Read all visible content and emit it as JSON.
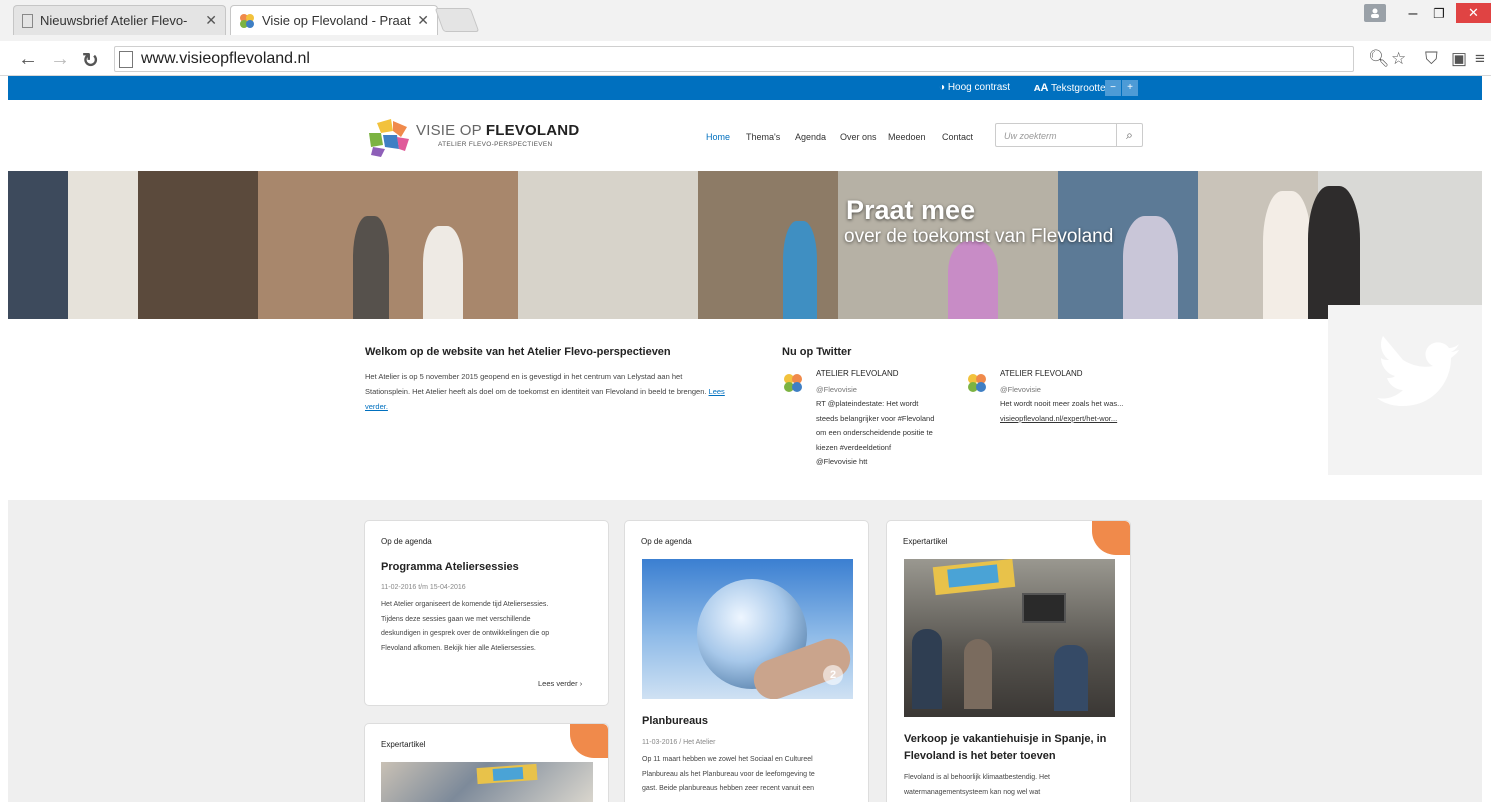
{
  "browser": {
    "tabs": [
      {
        "label": "Nieuwsbrief Atelier Flevo-"
      },
      {
        "label": "Visie op Flevoland - Praat"
      }
    ],
    "url": "www.visieopflevoland.nl",
    "close_glyph": "✕",
    "new_tab": ""
  },
  "util": {
    "contrast": "Hoog contrast",
    "text_size": "Tekstgrootte",
    "minus": "−",
    "plus": "+"
  },
  "header": {
    "logo_line1_light": "VISIE OP ",
    "logo_line1_bold": "FLEVOLAND",
    "logo_line2": "ATELIER FLEVO-PERSPECTIEVEN",
    "nav": [
      "Home",
      "Thema's",
      "Agenda",
      "Over ons",
      "Meedoen",
      "Contact"
    ],
    "search_placeholder": "Uw zoekterm"
  },
  "hero": {
    "headline": "Praat mee",
    "subline": "over de toekomst van Flevoland"
  },
  "welcome": {
    "title": "Welkom op de website van het Atelier Flevo-perspectieven",
    "text": "Het Atelier is op 5 november 2015 geopend en is gevestigd in het centrum van Lelystad aan het Stationsplein. Het Atelier heeft als doel om de toekomst en identiteit van Flevoland in beeld te brengen. ",
    "link": "Lees verder."
  },
  "twitter": {
    "title": "Nu op Twitter",
    "tweets": [
      {
        "name": "ATELIER FLEVOLAND",
        "handle": "@Flevovisie",
        "lines": [
          "RT @plateindestate: Het wordt",
          "steeds belangrijker voor #Flevoland",
          "om een onderscheidende positie te",
          "kiezen #verdeeldetionf",
          "@Flevovisie htt"
        ]
      },
      {
        "name": "ATELIER FLEVOLAND",
        "handle": "@Flevovisie",
        "lines": [
          "Het wordt nooit meer zoals het was...",
          "visieopflevoland.nl/expert/het-wor..."
        ]
      }
    ]
  },
  "cards": [
    {
      "category": "Op de agenda",
      "title": "Programma Ateliersessies",
      "date": "11-02-2016 t/m 15-04-2016",
      "lines": [
        "Het Atelier organiseert de komende tijd Ateliersessies.",
        "Tijdens deze sessies gaan we met verschillende",
        "deskundigen in gesprek over de ontwikkelingen die op",
        "Flevoland afkomen. Bekijk hier alle Ateliersessies."
      ],
      "more": "Lees verder ›"
    },
    {
      "category": "Expertartikel"
    },
    {
      "category": "Op de agenda",
      "image_badge": "2",
      "title": "Planbureaus",
      "date": "11-03-2016 / Het Atelier",
      "lines": [
        "Op 11 maart hebben we zowel het Sociaal en Cultureel",
        "Planbureau als het Planbureau voor de leefomgeving te",
        "gast. Beide planbureaus hebben zeer recent vanuit een"
      ]
    },
    {
      "category": "Expertartikel",
      "title_lines": [
        "Verkoop je vakantiehuisje in Spanje, in",
        "Flevoland is het beter toeven"
      ],
      "lines": [
        "Flevoland is al behoorlijk klimaatbestendig. Het",
        "watermanagementsysteem kan nog wel wat"
      ]
    }
  ],
  "colors": {
    "brand_blue": "#0070bf",
    "accent_orange": "#f08a4b",
    "grey_band": "#efefef"
  }
}
